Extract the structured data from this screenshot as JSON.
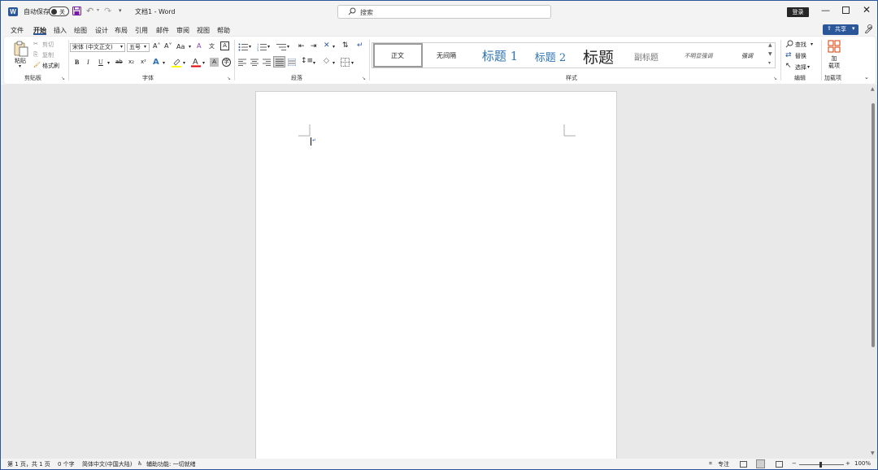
{
  "titlebar": {
    "app_icon_letter": "W",
    "autosave_label": "自动保存",
    "autosave_state": "关",
    "doc_title": "文档1  -  Word",
    "search_placeholder": "搜索",
    "login_label": "登录",
    "icons": [
      "word-icon",
      "save-icon",
      "undo-icon",
      "redo-icon",
      "customize-qa-icon",
      "search-icon",
      "minimize-icon",
      "maximize-icon",
      "close-icon"
    ]
  },
  "tabs": [
    "文件",
    "开始",
    "插入",
    "绘图",
    "设计",
    "布局",
    "引用",
    "邮件",
    "审阅",
    "视图",
    "帮助"
  ],
  "active_tab": "开始",
  "share_label": "共享",
  "ribbon": {
    "clipboard": {
      "paste": "粘贴",
      "cut": "剪切",
      "copy": "复制",
      "format_painter": "格式刷",
      "label": "剪贴板"
    },
    "font": {
      "font_name": "宋体 (中文正文)",
      "font_size": "五号",
      "grow": "A˄",
      "shrink": "A˅",
      "case": "Aa",
      "bold": "B",
      "italic": "I",
      "underline": "U",
      "strike": "ab",
      "subscript": "x₂",
      "superscript": "x²",
      "label": "字体"
    },
    "paragraph": {
      "label": "段落"
    },
    "styles": {
      "items": [
        "正文",
        "无间隔",
        "标题 1",
        "标题 2",
        "标题",
        "副标题",
        "不明显强调",
        "强调"
      ],
      "label": "样式"
    },
    "editing": {
      "find": "查找",
      "replace": "替换",
      "select": "选择",
      "label": "编辑"
    },
    "addins": {
      "button": "加\n载项",
      "label": "加载项"
    }
  },
  "statusbar": {
    "page": "第 1 页，共 1 页",
    "words": "0 个字",
    "language": "简体中文(中国大陆)",
    "accessibility": "辅助功能: 一切就绪",
    "focus": "专注",
    "zoom": "100%"
  },
  "colors": {
    "accent": "#2b579a",
    "highlight": "#ffff00",
    "font_color": "#e00000",
    "heading": "#2e74b5"
  }
}
